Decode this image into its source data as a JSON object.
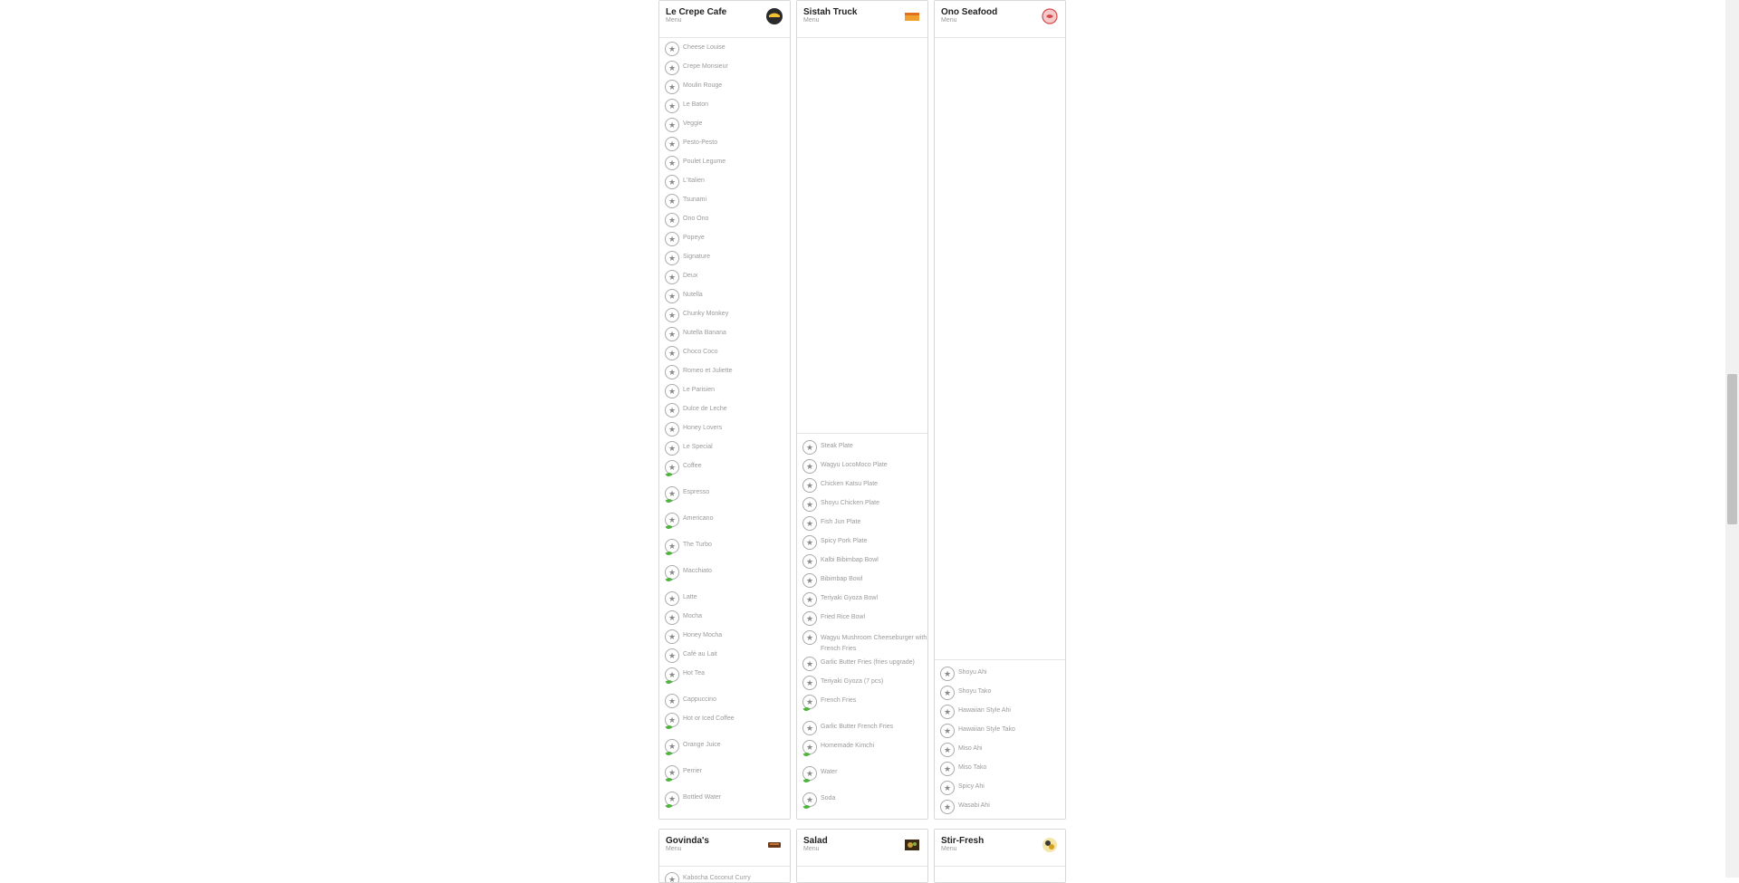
{
  "restaurants": [
    {
      "name": "Le Crepe Cafe",
      "subtitle": "Menu",
      "logo_icon": "crepe-cafe-logo",
      "items": [
        {
          "label": "Cheese Louise"
        },
        {
          "label": "Crepe Monsieur"
        },
        {
          "label": "Moulin Rouge"
        },
        {
          "label": "Le Baton"
        },
        {
          "label": "Veggie"
        },
        {
          "label": "Pesto-Pesto"
        },
        {
          "label": "Poulet Legume"
        },
        {
          "label": "L'Italien"
        },
        {
          "label": "Tsunami"
        },
        {
          "label": "Ono Ono"
        },
        {
          "label": "Popeye"
        },
        {
          "label": "Signature"
        },
        {
          "label": "Deux"
        },
        {
          "label": "Nutella"
        },
        {
          "label": "Chunky Monkey"
        },
        {
          "label": "Nutella Banana"
        },
        {
          "label": "Choco Coco"
        },
        {
          "label": "Romeo et Juliette"
        },
        {
          "label": "Le Parisien"
        },
        {
          "label": "Dulce de Leche"
        },
        {
          "label": "Honey Lovers"
        },
        {
          "label": "Le Special"
        },
        {
          "label": "Coffee",
          "vegan": true
        },
        {
          "label": "Espresso",
          "vegan": true
        },
        {
          "label": "Americano",
          "vegan": true
        },
        {
          "label": "The Turbo",
          "vegan": true
        },
        {
          "label": "Macchiato",
          "vegan": true
        },
        {
          "label": "Latte"
        },
        {
          "label": "Mocha"
        },
        {
          "label": "Honey Mocha"
        },
        {
          "label": "Café au Lait"
        },
        {
          "label": "Hot Tea",
          "vegan": true
        },
        {
          "label": "Cappuccino"
        },
        {
          "label": "Hot or Iced Coffee",
          "vegan": true
        },
        {
          "label": "Orange Juice",
          "vegan": true
        },
        {
          "label": "Perrier",
          "vegan": true
        },
        {
          "label": "Bottled Water",
          "vegan": true
        }
      ]
    },
    {
      "name": "Sistah Truck",
      "subtitle": "Menu",
      "logo_icon": "sistah-truck-logo",
      "items": [
        {
          "label": "Steak Plate"
        },
        {
          "label": "Wagyu LocoMoco Plate"
        },
        {
          "label": "Chicken Katsu Plate"
        },
        {
          "label": "Shoyu Chicken Plate"
        },
        {
          "label": "Fish Jun Plate"
        },
        {
          "label": "Spicy Pork Plate"
        },
        {
          "label": "Kalbi Bibimbap Bowl"
        },
        {
          "label": "Bibimbap Bowl"
        },
        {
          "label": "Teriyaki Gyoza Bowl"
        },
        {
          "label": "Fried Rice Bowl"
        },
        {
          "label": "Wagyu Mushroom Cheeseburger with French Fries",
          "wrap": true
        },
        {
          "label": "Garlic Butter Fries (fries upgrade)"
        },
        {
          "label": "Teriyaki Gyoza (7 pcs)"
        },
        {
          "label": "French Fries",
          "vegan": true
        },
        {
          "label": "Garlic Butter French Fries"
        },
        {
          "label": "Homemade Kimchi",
          "vegan": true
        },
        {
          "label": "Water",
          "vegan": true
        },
        {
          "label": "Soda",
          "vegan": true
        }
      ]
    },
    {
      "name": "Ono Seafood",
      "subtitle": "Menu",
      "logo_icon": "ono-seafood-logo",
      "items": [
        {
          "label": "Shoyu Ahi"
        },
        {
          "label": "Shoyu Tako"
        },
        {
          "label": "Hawaiian Style Ahi"
        },
        {
          "label": "Hawaiian Style Tako"
        },
        {
          "label": "Miso Ahi"
        },
        {
          "label": "Miso Tako"
        },
        {
          "label": "Spicy Ahi"
        },
        {
          "label": "Wasabi Ahi"
        }
      ]
    },
    {
      "name": "Govinda's",
      "subtitle": "Menu",
      "logo_icon": "govindas-logo",
      "items": [
        {
          "label": "Kabocha Coconut Curry"
        }
      ]
    },
    {
      "name": "Salad",
      "subtitle": "Menu",
      "logo_icon": "salad-logo",
      "items": []
    },
    {
      "name": "Stir-Fresh",
      "subtitle": "Menu",
      "logo_icon": "stir-fresh-logo",
      "items": []
    }
  ],
  "icons": {
    "star": "★",
    "vegan_leaf": "leaf-icon"
  },
  "colors": {
    "vegan_leaf": "#4db53a",
    "border": "#d8d8d8"
  }
}
